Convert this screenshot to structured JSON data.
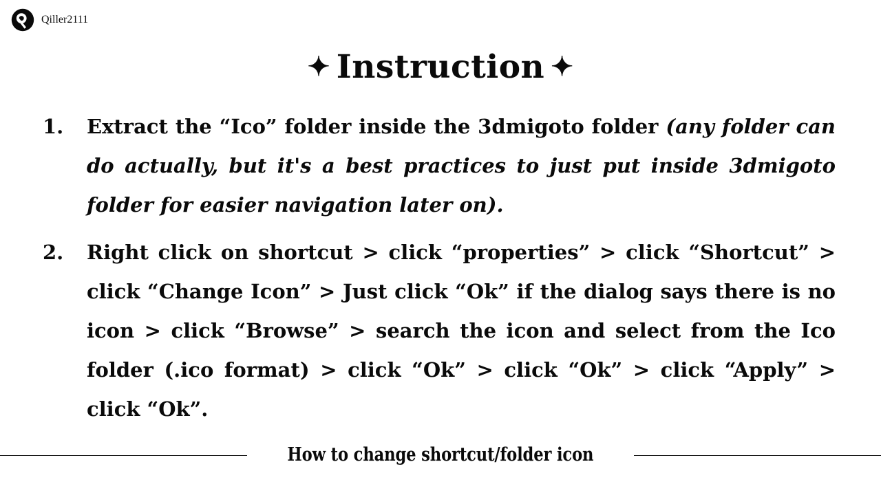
{
  "brand": {
    "name": "Qiller2111",
    "logo_icon": "qiller-circle-q-logo",
    "logo_bg_color": "#0a0a0a",
    "logo_fg_color": "#ffffff"
  },
  "title": {
    "text": "Instruction",
    "left_ornament": "✦",
    "right_ornament": "✦",
    "ornament_icon": "four-pointed-star-icon"
  },
  "instructions": {
    "steps": [
      {
        "number": "1.",
        "plain": "Extract the “Ico” folder inside the 3dmigoto folder ",
        "emphasis": "(any folder can do actually, but it's a best practices to just put inside 3dmigoto folder for easier navigation later on)."
      },
      {
        "number": "2.",
        "plain": "Right click on shortcut > click “properties” > click “Shortcut” > click “Change Icon” > Just click “Ok” if the dialog says there is no icon > click “Browse” > search the icon and select from the Ico folder (.ico format) > click “Ok” > click “Ok” > click “Apply” > click “Ok”.",
        "emphasis": ""
      }
    ]
  },
  "footer": {
    "text": "How to change shortcut/folder icon",
    "rule_color": "#121212"
  },
  "page": {
    "background_color": "#ffffff",
    "text_color": "#0a0a0a"
  }
}
